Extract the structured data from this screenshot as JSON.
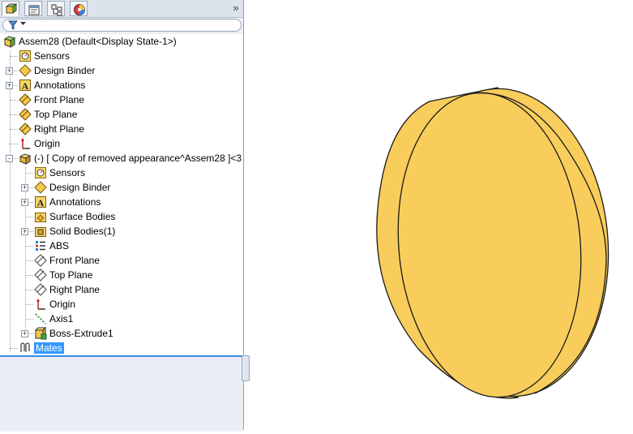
{
  "panel": {
    "tabs": [
      {
        "icon": "featuremanager-tree-icon"
      },
      {
        "icon": "property-manager-icon"
      },
      {
        "icon": "configuration-manager-icon"
      },
      {
        "icon": "display-manager-icon"
      }
    ],
    "expand_glyph": "»",
    "filter": {
      "icon": "filter-funnel-icon"
    }
  },
  "tree": {
    "root": "Assem28  (Default<Display State-1>)",
    "items": [
      "Sensors",
      "Design Binder",
      "Annotations",
      "Front Plane",
      "Top Plane",
      "Right Plane",
      "Origin",
      "(-) [ Copy of removed appearance^Assem28 ]<3",
      "Sensors",
      "Design Binder",
      "Annotations",
      "Surface Bodies",
      "Solid Bodies(1)",
      "ABS",
      "Front Plane",
      "Top Plane",
      "Right Plane",
      "Origin",
      "Axis1",
      "Boss-Extrude1",
      "Mates"
    ],
    "expander_symbol": "+",
    "collapse_symbol": "-"
  },
  "model": {
    "face_color": "#f9cd5c",
    "edge_color": "#1a1a1a"
  }
}
